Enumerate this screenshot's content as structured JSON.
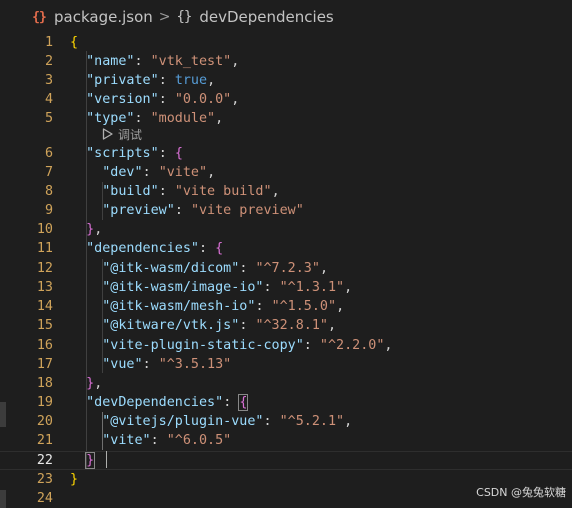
{
  "breadcrumb": {
    "file_icon": "json-braces-icon",
    "file": "package.json",
    "separator": ">",
    "symbol_icon": "{}",
    "symbol": "devDependencies"
  },
  "codelens": {
    "icon": "play-icon",
    "label": "调试"
  },
  "watermark": "CSDN @兔兔软糖",
  "colors": {
    "background": "#1e1e1e",
    "line_number": "#cfa35a",
    "key": "#9cdcfe",
    "string": "#ce9178",
    "keyword": "#569cd6",
    "bracket_level1": "#ffd700",
    "bracket_level2": "#da70d6",
    "bracket_level3": "#179fff"
  },
  "lines": [
    {
      "n": "1",
      "tokens": [
        [
          "b1",
          "{"
        ]
      ]
    },
    {
      "n": "2",
      "tokens": [
        [
          "ws",
          "  "
        ],
        [
          "key",
          "\"name\""
        ],
        [
          "pun",
          ": "
        ],
        [
          "str",
          "\"vtk_test\""
        ],
        [
          "pun",
          ","
        ]
      ]
    },
    {
      "n": "3",
      "tokens": [
        [
          "ws",
          "  "
        ],
        [
          "key",
          "\"private\""
        ],
        [
          "pun",
          ": "
        ],
        [
          "kw",
          "true"
        ],
        [
          "pun",
          ","
        ]
      ]
    },
    {
      "n": "4",
      "tokens": [
        [
          "ws",
          "  "
        ],
        [
          "key",
          "\"version\""
        ],
        [
          "pun",
          ": "
        ],
        [
          "str",
          "\"0.0.0\""
        ],
        [
          "pun",
          ","
        ]
      ]
    },
    {
      "n": "5",
      "tokens": [
        [
          "ws",
          "  "
        ],
        [
          "key",
          "\"type\""
        ],
        [
          "pun",
          ": "
        ],
        [
          "str",
          "\"module\""
        ],
        [
          "pun",
          ","
        ]
      ]
    },
    {
      "n": "6",
      "tokens": [
        [
          "ws",
          "  "
        ],
        [
          "key",
          "\"scripts\""
        ],
        [
          "pun",
          ": "
        ],
        [
          "b2",
          "{"
        ]
      ]
    },
    {
      "n": "7",
      "tokens": [
        [
          "ws",
          "    "
        ],
        [
          "key",
          "\"dev\""
        ],
        [
          "pun",
          ": "
        ],
        [
          "str",
          "\"vite\""
        ],
        [
          "pun",
          ","
        ]
      ]
    },
    {
      "n": "8",
      "tokens": [
        [
          "ws",
          "    "
        ],
        [
          "key",
          "\"build\""
        ],
        [
          "pun",
          ": "
        ],
        [
          "str",
          "\"vite build\""
        ],
        [
          "pun",
          ","
        ]
      ]
    },
    {
      "n": "9",
      "tokens": [
        [
          "ws",
          "    "
        ],
        [
          "key",
          "\"preview\""
        ],
        [
          "pun",
          ": "
        ],
        [
          "str",
          "\"vite preview\""
        ]
      ]
    },
    {
      "n": "10",
      "tokens": [
        [
          "ws",
          "  "
        ],
        [
          "b2",
          "}"
        ],
        [
          "pun",
          ","
        ]
      ]
    },
    {
      "n": "11",
      "tokens": [
        [
          "ws",
          "  "
        ],
        [
          "key",
          "\"dependencies\""
        ],
        [
          "pun",
          ": "
        ],
        [
          "b2",
          "{"
        ]
      ]
    },
    {
      "n": "12",
      "tokens": [
        [
          "ws",
          "    "
        ],
        [
          "key",
          "\"@itk-wasm/dicom\""
        ],
        [
          "pun",
          ": "
        ],
        [
          "str",
          "\"^7.2.3\""
        ],
        [
          "pun",
          ","
        ]
      ]
    },
    {
      "n": "13",
      "tokens": [
        [
          "ws",
          "    "
        ],
        [
          "key",
          "\"@itk-wasm/image-io\""
        ],
        [
          "pun",
          ": "
        ],
        [
          "str",
          "\"^1.3.1\""
        ],
        [
          "pun",
          ","
        ]
      ]
    },
    {
      "n": "14",
      "tokens": [
        [
          "ws",
          "    "
        ],
        [
          "key",
          "\"@itk-wasm/mesh-io\""
        ],
        [
          "pun",
          ": "
        ],
        [
          "str",
          "\"^1.5.0\""
        ],
        [
          "pun",
          ","
        ]
      ]
    },
    {
      "n": "15",
      "tokens": [
        [
          "ws",
          "    "
        ],
        [
          "key",
          "\"@kitware/vtk.js\""
        ],
        [
          "pun",
          ": "
        ],
        [
          "str",
          "\"^32.8.1\""
        ],
        [
          "pun",
          ","
        ]
      ]
    },
    {
      "n": "16",
      "tokens": [
        [
          "ws",
          "    "
        ],
        [
          "key",
          "\"vite-plugin-static-copy\""
        ],
        [
          "pun",
          ": "
        ],
        [
          "str",
          "\"^2.2.0\""
        ],
        [
          "pun",
          ","
        ]
      ]
    },
    {
      "n": "17",
      "tokens": [
        [
          "ws",
          "    "
        ],
        [
          "key",
          "\"vue\""
        ],
        [
          "pun",
          ": "
        ],
        [
          "str",
          "\"^3.5.13\""
        ]
      ]
    },
    {
      "n": "18",
      "tokens": [
        [
          "ws",
          "  "
        ],
        [
          "b2",
          "}"
        ],
        [
          "pun",
          ","
        ]
      ]
    },
    {
      "n": "19",
      "tokens": [
        [
          "ws",
          "  "
        ],
        [
          "key",
          "\"devDependencies\""
        ],
        [
          "pun",
          ": "
        ],
        [
          "b2h",
          "{"
        ]
      ]
    },
    {
      "n": "20",
      "tokens": [
        [
          "ws",
          "    "
        ],
        [
          "key",
          "\"@vitejs/plugin-vue\""
        ],
        [
          "pun",
          ": "
        ],
        [
          "str",
          "\"^5.2.1\""
        ],
        [
          "pun",
          ","
        ]
      ]
    },
    {
      "n": "21",
      "tokens": [
        [
          "ws",
          "    "
        ],
        [
          "key",
          "\"vite\""
        ],
        [
          "pun",
          ": "
        ],
        [
          "str",
          "\"^6.0.5\""
        ]
      ]
    },
    {
      "n": "22",
      "tokens": [
        [
          "ws",
          "  "
        ],
        [
          "b2h",
          "}"
        ]
      ],
      "current": true
    },
    {
      "n": "23",
      "tokens": [
        [
          "b1",
          "}"
        ]
      ]
    },
    {
      "n": "24",
      "tokens": []
    }
  ]
}
